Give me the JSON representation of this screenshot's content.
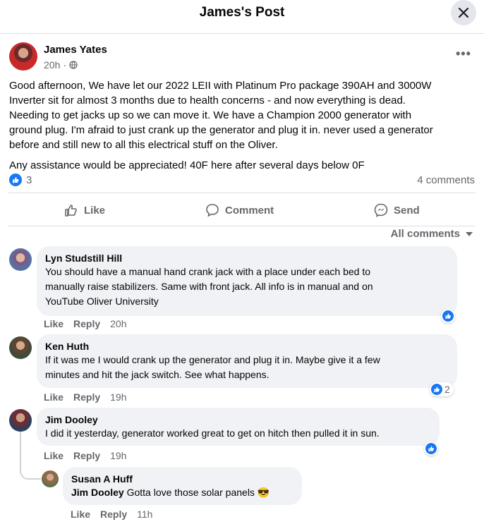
{
  "header": {
    "title": "James's Post"
  },
  "post": {
    "author": "James Yates",
    "time": "20h",
    "body": "Good afternoon,  We have let our 2022 LEII with Platinum Pro package 390AH and 3000W\nInverter sit for almost 3 months due to health concerns - and now everything is dead.\nNeeding to get jacks up so we can move it.  We have a Champion 2000 generator with\nground plug.  I'm afraid to just crank up the generator and plug it in.  never used a generator\nbefore and still new to all this electrical stuff on the Oliver.",
    "body2": "Any assistance would be appreciated!  40F here after several days below 0F",
    "reaction_count": "3",
    "comment_count": "4 comments"
  },
  "actions": {
    "like": "Like",
    "comment": "Comment",
    "send": "Send"
  },
  "all_comments_label": "All comments",
  "comments": [
    {
      "name": "Lyn Studstill Hill",
      "text": "You should have a manual hand crank jack with a place under each bed to\nmanually raise stabilizers. Same with front jack. All info is in manual and on\nYouTube Oliver University",
      "like": "Like",
      "reply": "Reply",
      "time": "20h",
      "reactions": ""
    },
    {
      "name": "Ken Huth",
      "text": "If it was me I would crank up the generator and plug it in. Maybe give it a few\nminutes and hit the jack switch. See what happens.",
      "like": "Like",
      "reply": "Reply",
      "time": "19h",
      "reactions": "2"
    },
    {
      "name": "Jim Dooley",
      "text": "I did it yesterday, generator worked great to get on hitch then pulled it in sun.",
      "like": "Like",
      "reply": "Reply",
      "time": "19h",
      "reactions": ""
    }
  ],
  "reply": {
    "name": "Susan A Huff",
    "mention": "Jim Dooley",
    "text": "Gotta love those solar panels 😎",
    "like": "Like",
    "reply": "Reply",
    "time": "11h"
  },
  "colors": {
    "like_blue": "#1877f2",
    "bubble": "#f0f2f5",
    "secondary_text": "#65676b"
  }
}
